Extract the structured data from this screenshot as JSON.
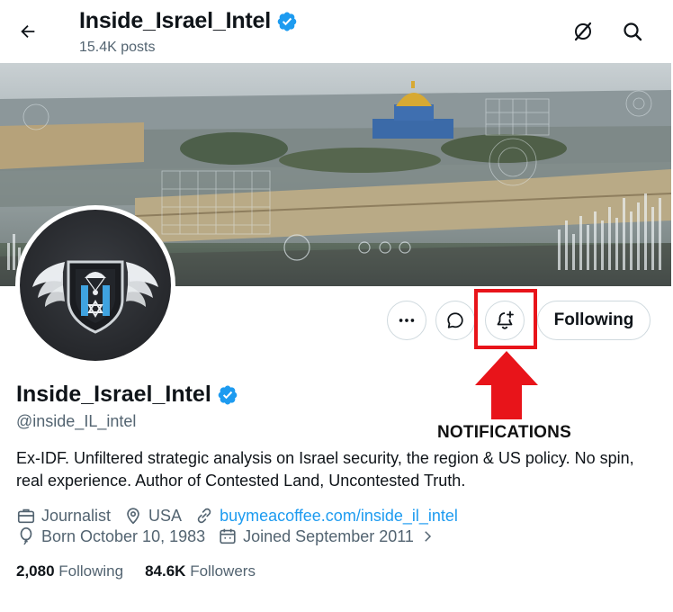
{
  "header": {
    "title": "Inside_Israel_Intel",
    "posts_count": "15.4K posts"
  },
  "profile": {
    "display_name": "Inside_Israel_Intel",
    "handle": "@inside_IL_intel",
    "verified": true,
    "bio": "Ex-IDF. Unfiltered strategic analysis on Israel security, the region & US policy. No spin, real experience. Author of Contested Land, Uncontested Truth.",
    "profession": "Journalist",
    "location": "USA",
    "website": "buymeacoffee.com/inside_il_intel",
    "born": "Born October 10, 1983",
    "joined": "Joined September 2011"
  },
  "stats": {
    "following_count": "2,080",
    "following_label": "Following",
    "followers_count": "84.6K",
    "followers_label": "Followers"
  },
  "actions": {
    "following_button": "Following"
  },
  "annotation": {
    "label": "NOTIFICATIONS",
    "color": "#e8141a"
  },
  "colors": {
    "verified_blue": "#1d9bf0",
    "link_blue": "#1d9bf0",
    "muted_text": "#536471"
  },
  "icons": {
    "back": "arrow-left-icon",
    "grok": "grok-icon",
    "search": "search-icon",
    "more": "more-dots-icon",
    "message": "message-icon",
    "notify": "bell-plus-icon",
    "profession": "briefcase-icon",
    "location": "location-pin-icon",
    "website": "link-icon",
    "birthday": "balloon-icon",
    "calendar": "calendar-icon"
  }
}
